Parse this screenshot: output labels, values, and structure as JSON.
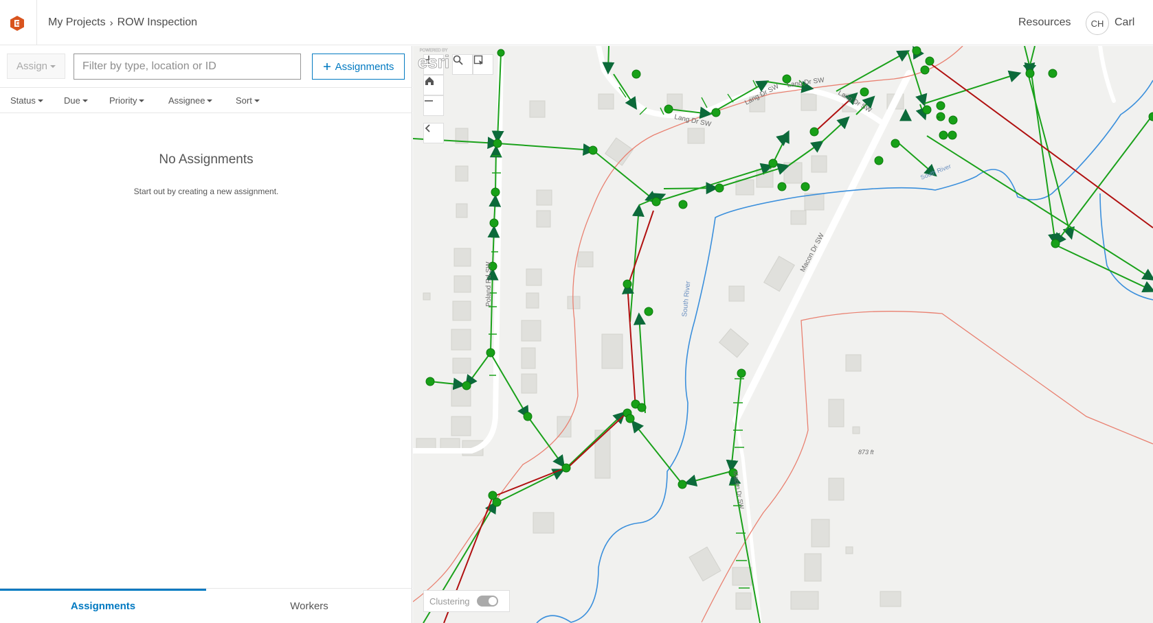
{
  "header": {
    "logo_icon": "app-logo-icon",
    "breadcrumb": {
      "root": "My Projects",
      "separator": "›",
      "current": "ROW Inspection"
    },
    "resources_label": "Resources",
    "user": {
      "initials": "CH",
      "name": "Carl"
    }
  },
  "toolbar": {
    "assign_label": "Assign",
    "filter_placeholder": "Filter by type, location or ID",
    "add_assignments_label": "Assignments"
  },
  "sort_filters": [
    {
      "label": "Status"
    },
    {
      "label": "Due"
    },
    {
      "label": "Priority"
    },
    {
      "label": "Assignee"
    },
    {
      "label": "Sort"
    }
  ],
  "empty_state": {
    "title": "No Assignments",
    "subtitle": "Start out by creating a new assignment."
  },
  "tabs": [
    {
      "label": "Assignments",
      "active": true
    },
    {
      "label": "Workers",
      "active": false
    }
  ],
  "map": {
    "controls": [
      "zoom-in-icon",
      "home-icon",
      "zoom-out-icon",
      "search-icon",
      "select-icon",
      "collapse-panel-icon"
    ],
    "clustering_label": "Clustering",
    "clustering_enabled": false,
    "labels": {
      "lang1": "Lang Dr SW",
      "lang2": "Lang Dr SW",
      "lang3": "Lang Dr SW",
      "lang4": "Lang Dr SW",
      "poland": "Poland Rd SW",
      "macon": "Macon Dr SW",
      "river1": "South River",
      "river2": "South River",
      "elevation": "873 ft",
      "bottom_road": "Macon Dr SW"
    },
    "attribution": "POWERED BY esri",
    "colors": {
      "pipe_green": "#1aa11a",
      "pipe_red": "#b01010",
      "node": "#18a018",
      "river": "#3a8fdc",
      "contour": "#e98070",
      "accent": "#0079c1"
    }
  }
}
